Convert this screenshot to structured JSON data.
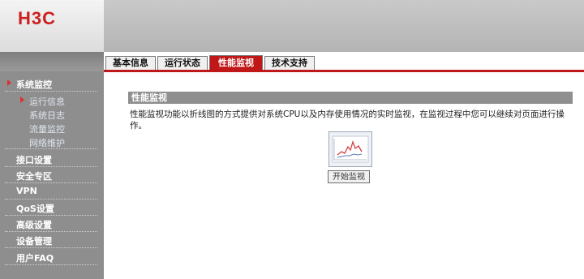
{
  "brand": {
    "logo_text": "H3C",
    "logo_color": "#cc1f1f"
  },
  "colors": {
    "accent": "#c01818",
    "sidebar": "#8e8e8e",
    "section_bar": "#8f8f8f"
  },
  "sidebar": {
    "items": [
      {
        "label": "系统监控",
        "active": true
      },
      {
        "label": "运行信息",
        "sub": true,
        "active": true
      },
      {
        "label": "系统日志",
        "sub": true
      },
      {
        "label": "流量监控",
        "sub": true
      },
      {
        "label": "网络维护",
        "sub": true
      },
      {
        "label": "接口设置"
      },
      {
        "label": "安全专区"
      },
      {
        "label": "VPN"
      },
      {
        "label": "QoS设置"
      },
      {
        "label": "高级设置"
      },
      {
        "label": "设备管理"
      },
      {
        "label": "用户FAQ"
      }
    ]
  },
  "tabs": [
    {
      "label": "基本信息"
    },
    {
      "label": "运行状态"
    },
    {
      "label": "性能监视",
      "active": true
    },
    {
      "label": "技术支持"
    }
  ],
  "main": {
    "section_title": "性能监视",
    "description": "性能监视功能以折线图的方式提供对系统CPU以及内存使用情况的实时监视，在监视过程中您可以继续对页面进行操作。",
    "thumbnail_icon": "line-chart-icon",
    "start_button": "开始监视"
  }
}
